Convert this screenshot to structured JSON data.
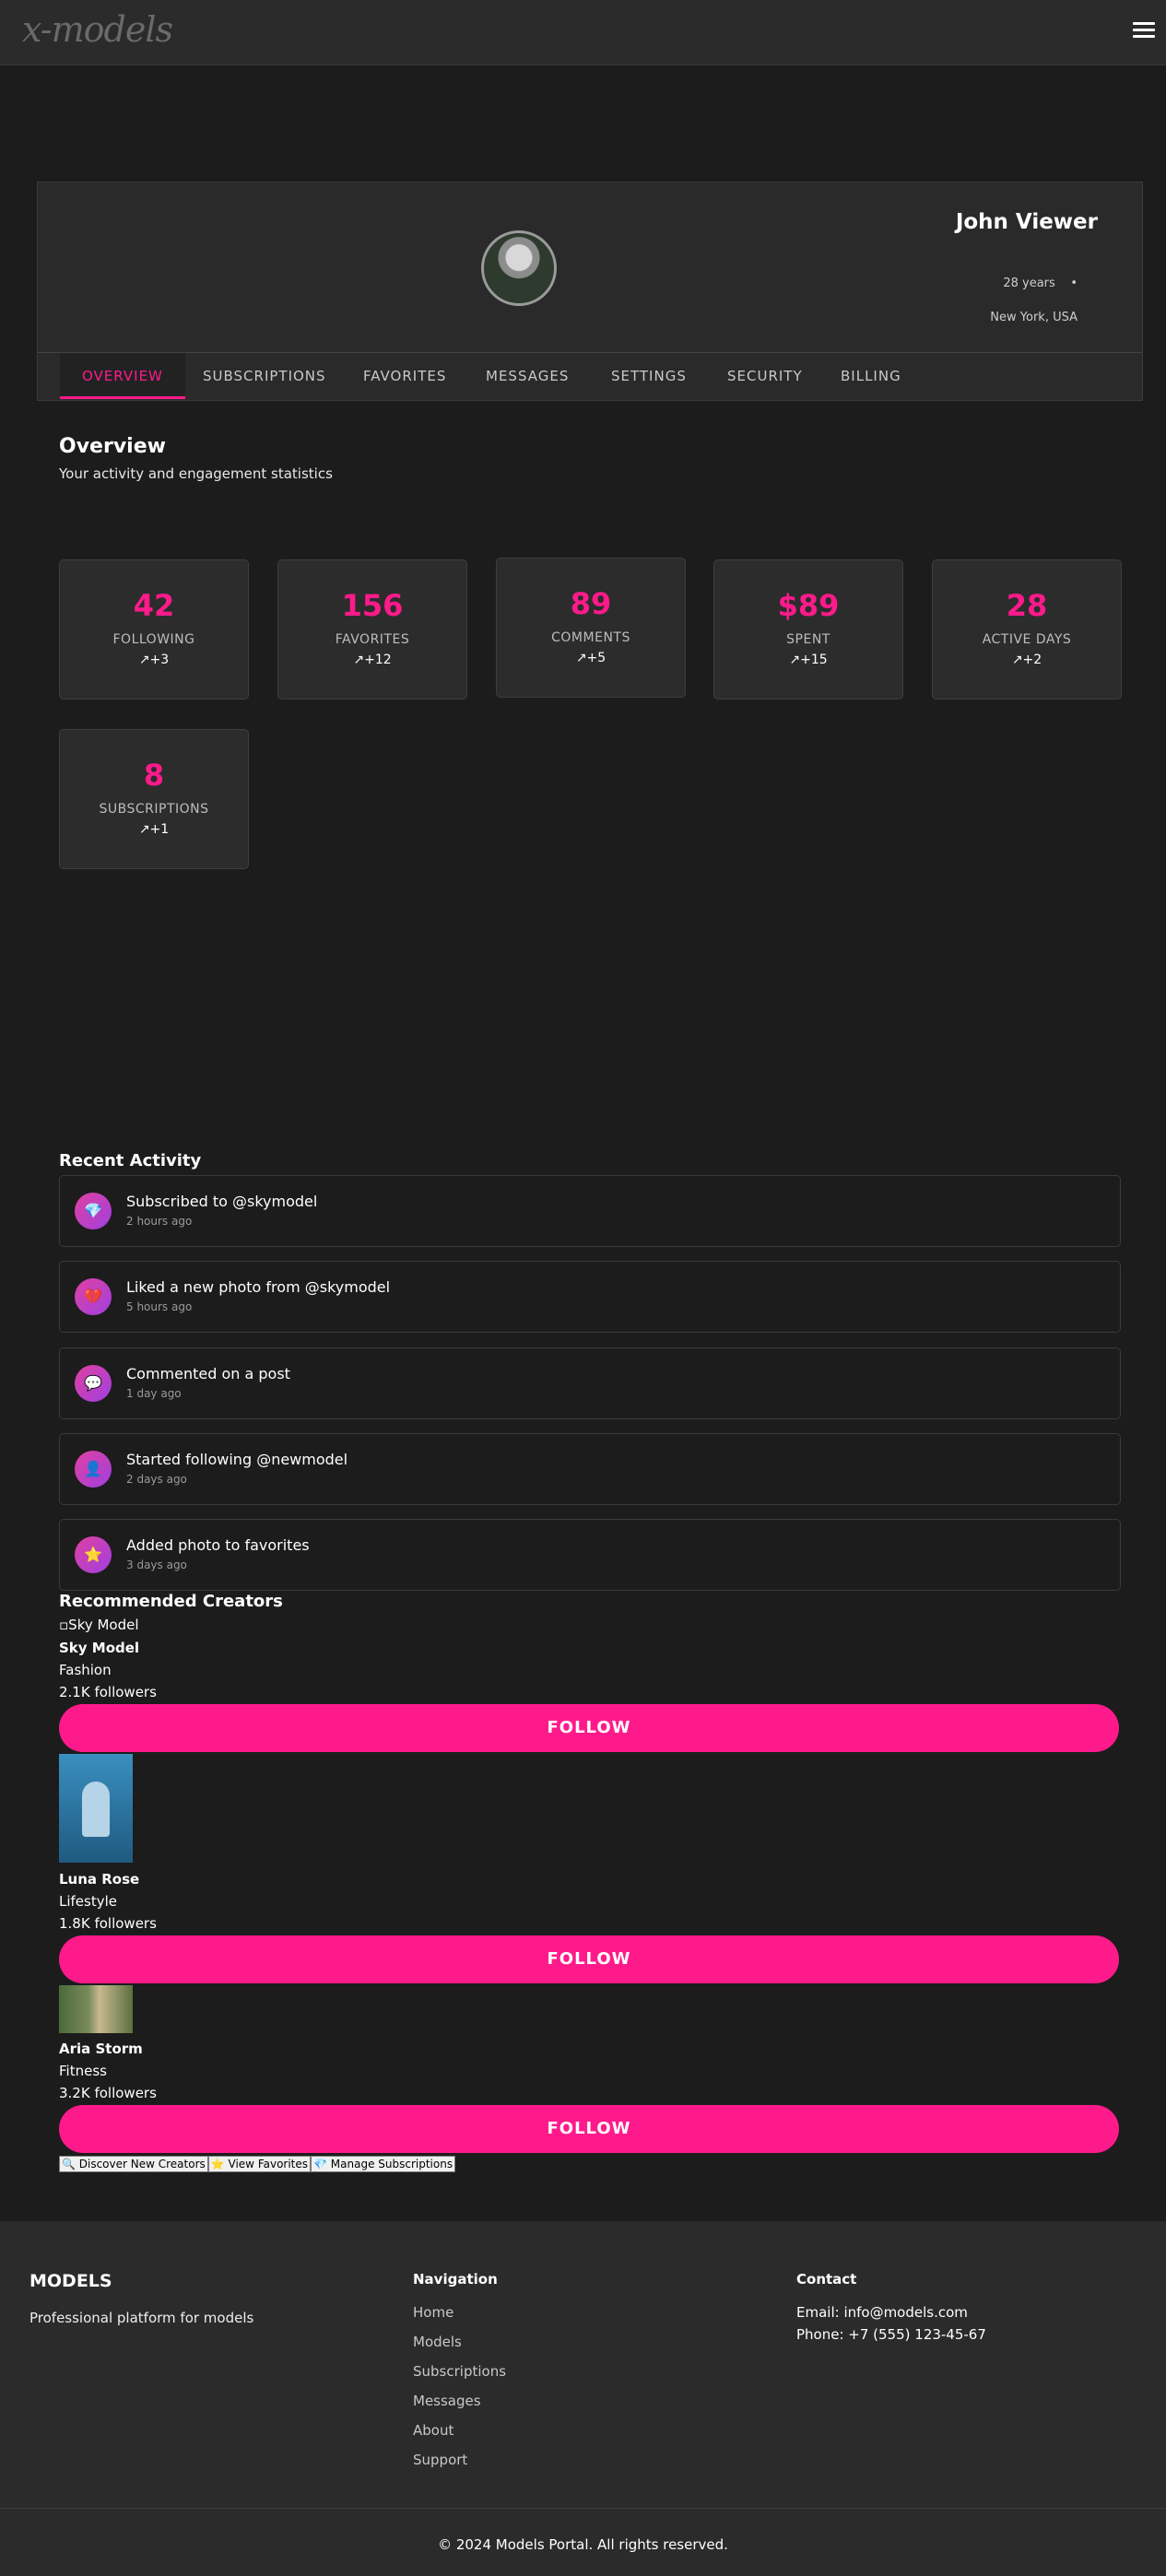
{
  "header": {
    "logo": "x-models",
    "menu_icon": "hamburger-icon"
  },
  "profile": {
    "name": "John Viewer",
    "age": "28 years",
    "separator": "•",
    "location": "New York, USA",
    "tabs": [
      "OVERVIEW",
      "SUBSCRIPTIONS",
      "FAVORITES",
      "MESSAGES",
      "SETTINGS",
      "SECURITY",
      "BILLING"
    ],
    "active_tab": "OVERVIEW"
  },
  "overview": {
    "title": "Overview",
    "subtitle": "Your activity and engagement statistics"
  },
  "stats": [
    {
      "value": "42",
      "label": "FOLLOWING",
      "change": "↗+3"
    },
    {
      "value": "156",
      "label": "FAVORITES",
      "change": "↗+12"
    },
    {
      "value": "89",
      "label": "COMMENTS",
      "change": "↗+5"
    },
    {
      "value": "$89",
      "label": "SPENT",
      "change": "↗+15"
    },
    {
      "value": "28",
      "label": "ACTIVE DAYS",
      "change": "↗+2"
    },
    {
      "value": "8",
      "label": "SUBSCRIPTIONS",
      "change": "↗+1"
    }
  ],
  "activity": {
    "title": "Recent Activity",
    "items": [
      {
        "icon": "gem-icon",
        "glyph": "💎",
        "text": "Subscribed to @skymodel",
        "time": "2 hours ago"
      },
      {
        "icon": "heart-icon",
        "glyph": "💔",
        "text": "Liked a new photo from @skymodel",
        "time": "5 hours ago"
      },
      {
        "icon": "speech-bubble-icon",
        "glyph": "💬",
        "text": "Commented on a post",
        "time": "1 day ago"
      },
      {
        "icon": "user-icon",
        "glyph": "👤",
        "text": "Started following @newmodel",
        "time": "2 days ago"
      },
      {
        "icon": "star-icon",
        "glyph": "⭐",
        "text": "Added photo to favorites",
        "time": "3 days ago"
      }
    ]
  },
  "recommended": {
    "title": "Recommended Creators",
    "creators": [
      {
        "alt": "Sky Model",
        "name": "Sky Model",
        "category": "Fashion",
        "followers": "2.1K followers",
        "button": "FOLLOW"
      },
      {
        "alt": "Luna Rose",
        "name": "Luna Rose",
        "category": "Lifestyle",
        "followers": "1.8K followers",
        "button": "FOLLOW"
      },
      {
        "alt": "Aria Storm",
        "name": "Aria Storm",
        "category": "Fitness",
        "followers": "3.2K followers",
        "button": "FOLLOW"
      }
    ]
  },
  "quick_actions": [
    "🔍 Discover New Creators",
    "⭐ View Favorites",
    "💎 Manage Subscriptions"
  ],
  "footer": {
    "brand": "MODELS",
    "description": "Professional platform for models",
    "nav_title": "Navigation",
    "nav": [
      "Home",
      "Models",
      "Subscriptions",
      "Messages",
      "About",
      "Support"
    ],
    "contact_title": "Contact",
    "email": "Email: info@models.com",
    "phone": "Phone: +7 (555) 123-45-67",
    "copyright": "© 2024 Models Portal. All rights reserved."
  },
  "colors": {
    "accent": "#ff1a8c",
    "background": "#1c1c1c",
    "panel": "#2b2b2b"
  }
}
